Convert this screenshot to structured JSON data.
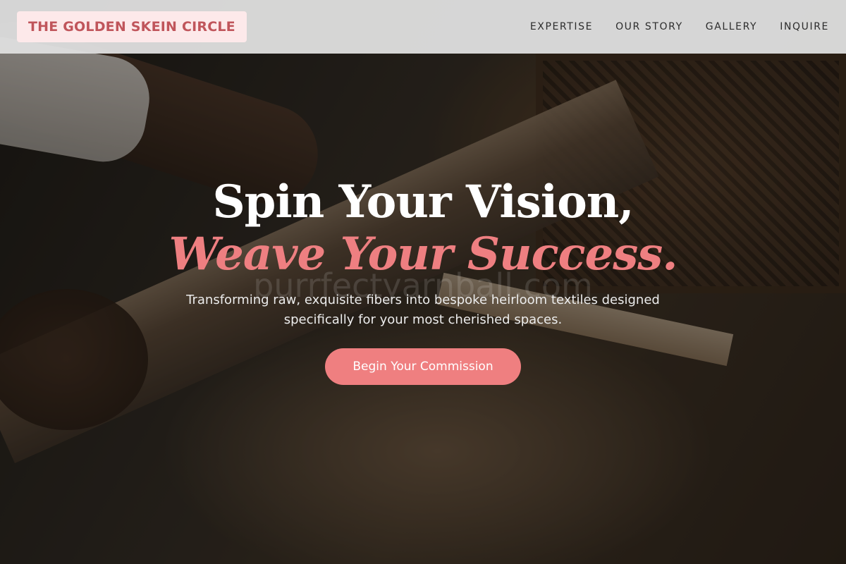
{
  "header": {
    "brand": "THE GOLDEN SKEIN CIRCLE",
    "nav": [
      "EXPERTISE",
      "OUR STORY",
      "GALLERY",
      "INQUIRE"
    ]
  },
  "hero": {
    "headline_line1": "Spin Your Vision,",
    "headline_line2": "Weave Your Success.",
    "watermark": "purrfectyarnball.com",
    "tagline": "Transforming raw, exquisite fibers into bespoke heirloom textiles designed specifically for your most cherished spaces.",
    "cta_label": "Begin Your Commission"
  },
  "colors": {
    "accent": "#ef7f80",
    "brand_text": "#c0555b",
    "brand_bg": "#fde9ea",
    "navbar_bg": "#dedede",
    "headline": "#ffffff"
  }
}
